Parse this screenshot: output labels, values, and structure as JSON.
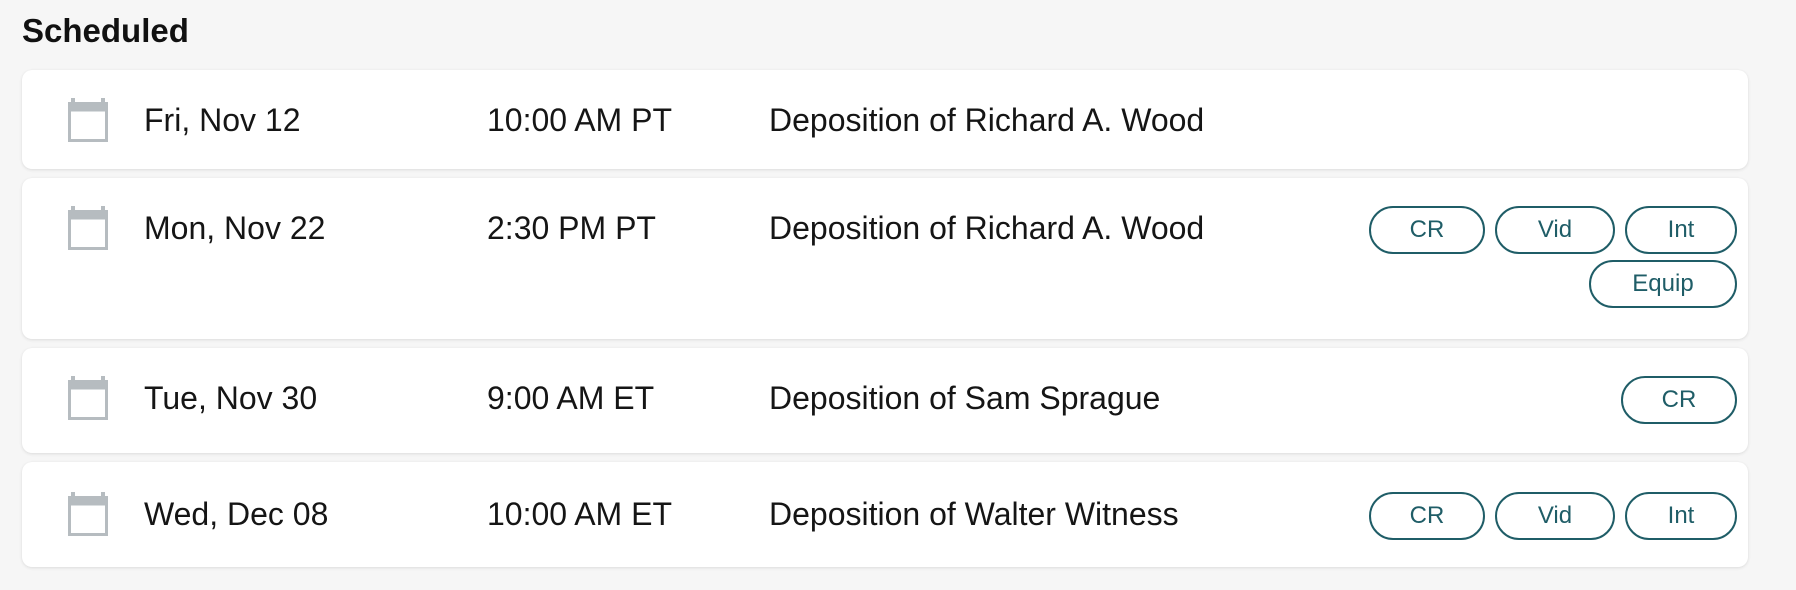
{
  "section": {
    "title": "Scheduled"
  },
  "icons": {
    "calendar": "calendar-icon"
  },
  "colors": {
    "page_background": "#f6f6f6",
    "card_background": "#ffffff",
    "pill_border": "#1f5d67",
    "pill_text": "#1f5d67",
    "icon_gray": "#b6bcc0"
  },
  "events": [
    {
      "date": "Fri, Nov 12",
      "time": "10:00 AM PT",
      "title": "Deposition of Richard A. Wood",
      "tags": []
    },
    {
      "date": "Mon, Nov 22",
      "time": "2:30 PM PT",
      "title": "Deposition of Richard A. Wood",
      "tags": [
        "CR",
        "Vid",
        "Int",
        "Equip"
      ]
    },
    {
      "date": "Tue, Nov 30",
      "time": "9:00 AM ET",
      "title": "Deposition of Sam Sprague",
      "tags": [
        "CR"
      ]
    },
    {
      "date": "Wed, Dec 08",
      "time": "10:00 AM ET",
      "title": "Deposition of Walter Witness",
      "tags": [
        "CR",
        "Vid",
        "Int"
      ]
    }
  ]
}
